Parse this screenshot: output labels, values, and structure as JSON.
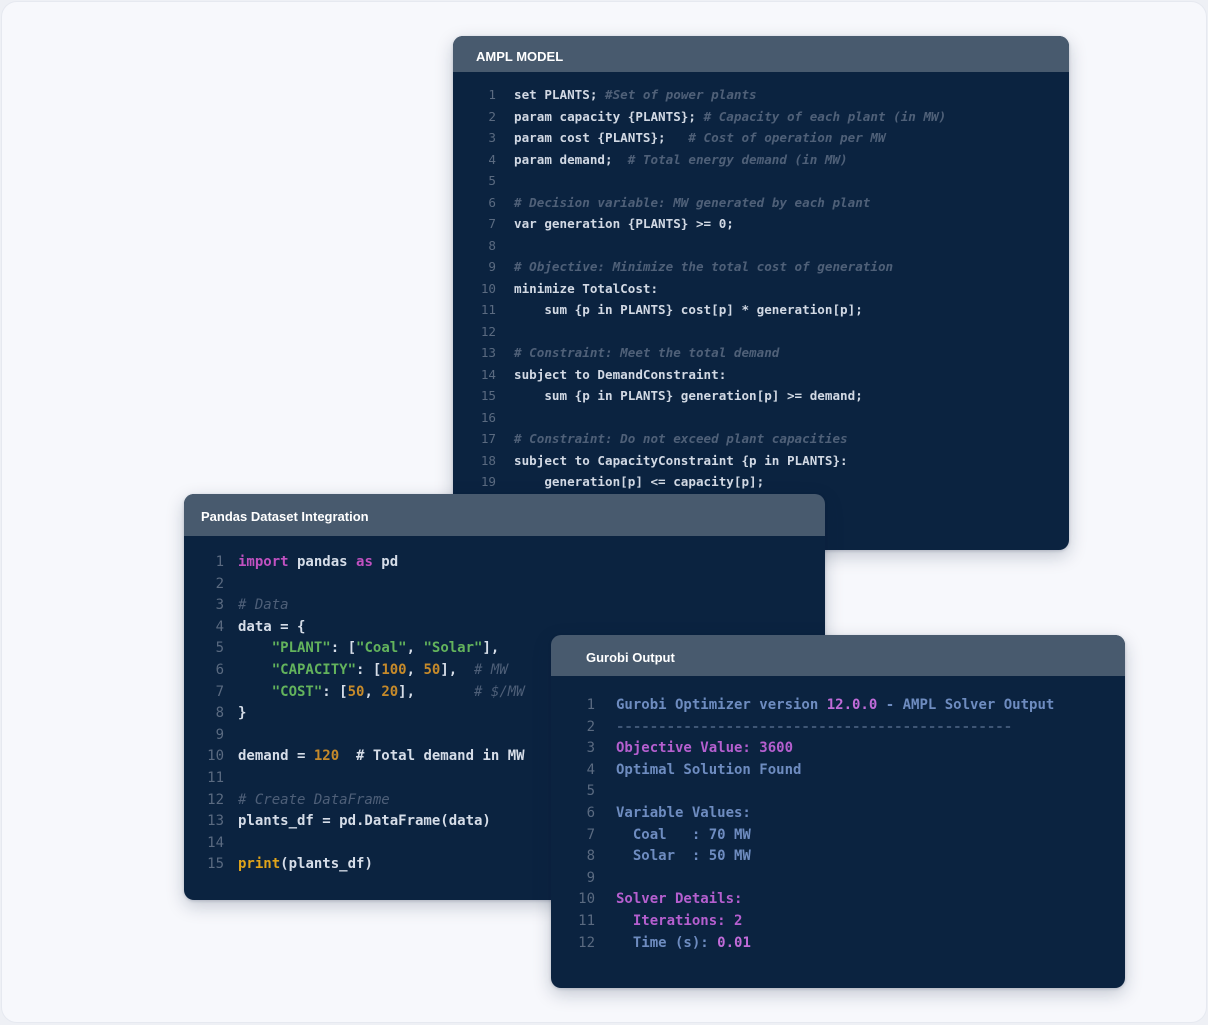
{
  "ampl": {
    "title": "AMPL MODEL",
    "lines": [
      {
        "n": "1",
        "s": [
          {
            "c": "code",
            "t": "set PLANTS; "
          },
          {
            "c": "comment",
            "t": "#Set of power plants"
          }
        ]
      },
      {
        "n": "2",
        "s": [
          {
            "c": "code",
            "t": "param capacity {PLANTS}; "
          },
          {
            "c": "comment",
            "t": "# Capacity of each plant (in MW)"
          }
        ]
      },
      {
        "n": "3",
        "s": [
          {
            "c": "code",
            "t": "param cost {PLANTS};   "
          },
          {
            "c": "comment",
            "t": "# Cost of operation per MW"
          }
        ]
      },
      {
        "n": "4",
        "s": [
          {
            "c": "code",
            "t": "param demand;  "
          },
          {
            "c": "comment",
            "t": "# Total energy demand (in MW)"
          }
        ]
      },
      {
        "n": "5",
        "s": []
      },
      {
        "n": "6",
        "s": [
          {
            "c": "comment",
            "t": "# Decision variable: MW generated by each plant"
          }
        ]
      },
      {
        "n": "7",
        "s": [
          {
            "c": "code",
            "t": "var generation {PLANTS} >= 0;"
          }
        ]
      },
      {
        "n": "8",
        "s": []
      },
      {
        "n": "9",
        "s": [
          {
            "c": "comment",
            "t": "# Objective: Minimize the total cost of generation"
          }
        ]
      },
      {
        "n": "10",
        "s": [
          {
            "c": "code",
            "t": "minimize TotalCost:"
          }
        ]
      },
      {
        "n": "11",
        "s": [
          {
            "c": "code",
            "t": "    sum {p in PLANTS} cost[p] * generation[p];"
          }
        ]
      },
      {
        "n": "12",
        "s": []
      },
      {
        "n": "13",
        "s": [
          {
            "c": "comment",
            "t": "# Constraint: Meet the total demand"
          }
        ]
      },
      {
        "n": "14",
        "s": [
          {
            "c": "code",
            "t": "subject to DemandConstraint:"
          }
        ]
      },
      {
        "n": "15",
        "s": [
          {
            "c": "code",
            "t": "    sum {p in PLANTS} generation[p] >= demand;"
          }
        ]
      },
      {
        "n": "16",
        "s": []
      },
      {
        "n": "17",
        "s": [
          {
            "c": "comment",
            "t": "# Constraint: Do not exceed plant capacities"
          }
        ]
      },
      {
        "n": "18",
        "s": [
          {
            "c": "code",
            "t": "subject to CapacityConstraint {p in PLANTS}:"
          }
        ]
      },
      {
        "n": "19",
        "s": [
          {
            "c": "code",
            "t": "    generation[p] <= capacity[p];"
          }
        ]
      }
    ]
  },
  "pandas": {
    "title": "Pandas Dataset Integration",
    "lines": [
      {
        "n": "1",
        "s": [
          {
            "c": "kw",
            "t": "import"
          },
          {
            "c": "code",
            "t": " pandas "
          },
          {
            "c": "kw",
            "t": "as"
          },
          {
            "c": "code",
            "t": " pd"
          }
        ]
      },
      {
        "n": "2",
        "s": []
      },
      {
        "n": "3",
        "s": [
          {
            "c": "comment",
            "t": "# Data"
          }
        ]
      },
      {
        "n": "4",
        "s": [
          {
            "c": "code",
            "t": "data = {"
          }
        ]
      },
      {
        "n": "5",
        "s": [
          {
            "c": "code",
            "t": "    "
          },
          {
            "c": "str",
            "t": "\"PLANT\""
          },
          {
            "c": "code",
            "t": ": ["
          },
          {
            "c": "str",
            "t": "\"Coal\""
          },
          {
            "c": "code",
            "t": ", "
          },
          {
            "c": "str",
            "t": "\"Solar\""
          },
          {
            "c": "code",
            "t": "],"
          }
        ]
      },
      {
        "n": "6",
        "s": [
          {
            "c": "code",
            "t": "    "
          },
          {
            "c": "str",
            "t": "\"CAPACITY\""
          },
          {
            "c": "code",
            "t": ": ["
          },
          {
            "c": "num",
            "t": "100"
          },
          {
            "c": "code",
            "t": ", "
          },
          {
            "c": "num",
            "t": "50"
          },
          {
            "c": "code",
            "t": "],  "
          },
          {
            "c": "comment",
            "t": "# MW"
          }
        ]
      },
      {
        "n": "7",
        "s": [
          {
            "c": "code",
            "t": "    "
          },
          {
            "c": "str",
            "t": "\"COST\""
          },
          {
            "c": "code",
            "t": ": ["
          },
          {
            "c": "num",
            "t": "50"
          },
          {
            "c": "code",
            "t": ", "
          },
          {
            "c": "num",
            "t": "20"
          },
          {
            "c": "code",
            "t": "],       "
          },
          {
            "c": "comment",
            "t": "# $/MW"
          }
        ]
      },
      {
        "n": "8",
        "s": [
          {
            "c": "code",
            "t": "}"
          }
        ]
      },
      {
        "n": "9",
        "s": []
      },
      {
        "n": "10",
        "s": [
          {
            "c": "code",
            "t": "demand = "
          },
          {
            "c": "num",
            "t": "120"
          },
          {
            "c": "code",
            "t": "  # Total demand in MW"
          }
        ]
      },
      {
        "n": "11",
        "s": []
      },
      {
        "n": "12",
        "s": [
          {
            "c": "comment",
            "t": "# Create DataFrame"
          }
        ]
      },
      {
        "n": "13",
        "s": [
          {
            "c": "code",
            "t": "plants_df = pd.DataFrame(data)"
          }
        ]
      },
      {
        "n": "14",
        "s": []
      },
      {
        "n": "15",
        "s": [
          {
            "c": "fn",
            "t": "print"
          },
          {
            "c": "code",
            "t": "(plants_df)"
          }
        ]
      }
    ]
  },
  "gurobi": {
    "title": "Gurobi Output",
    "lines": [
      {
        "n": "1",
        "s": [
          {
            "c": "blue",
            "t": "Gurobi Optimizer version "
          },
          {
            "c": "purple",
            "t": "12.0.0"
          },
          {
            "c": "blue",
            "t": " - AMPL Solver Output"
          }
        ]
      },
      {
        "n": "2",
        "s": [
          {
            "c": "sep",
            "t": "-----------------------------------------------"
          }
        ]
      },
      {
        "n": "3",
        "s": [
          {
            "c": "violet",
            "t": "Objective Value: 3600"
          }
        ]
      },
      {
        "n": "4",
        "s": [
          {
            "c": "blue",
            "t": "Optimal Solution Found"
          }
        ]
      },
      {
        "n": "5",
        "s": []
      },
      {
        "n": "6",
        "s": [
          {
            "c": "blue",
            "t": "Variable Values:"
          }
        ]
      },
      {
        "n": "7",
        "s": [
          {
            "c": "blue",
            "t": "  Coal   : 70 MW"
          }
        ]
      },
      {
        "n": "8",
        "s": [
          {
            "c": "blue",
            "t": "  Solar  : 50 MW"
          }
        ]
      },
      {
        "n": "9",
        "s": []
      },
      {
        "n": "10",
        "s": [
          {
            "c": "violet",
            "t": "Solver Details:"
          }
        ]
      },
      {
        "n": "11",
        "s": [
          {
            "c": "violet",
            "t": "  Iterations: 2"
          }
        ]
      },
      {
        "n": "12",
        "s": [
          {
            "c": "blue",
            "t": "  Time (s): "
          },
          {
            "c": "purple",
            "t": "0.01"
          }
        ]
      }
    ]
  },
  "colors": {
    "panel_bg": "#0b2340",
    "header_bg": "#485a6e",
    "canvas_bg": "#f7f8fc"
  }
}
